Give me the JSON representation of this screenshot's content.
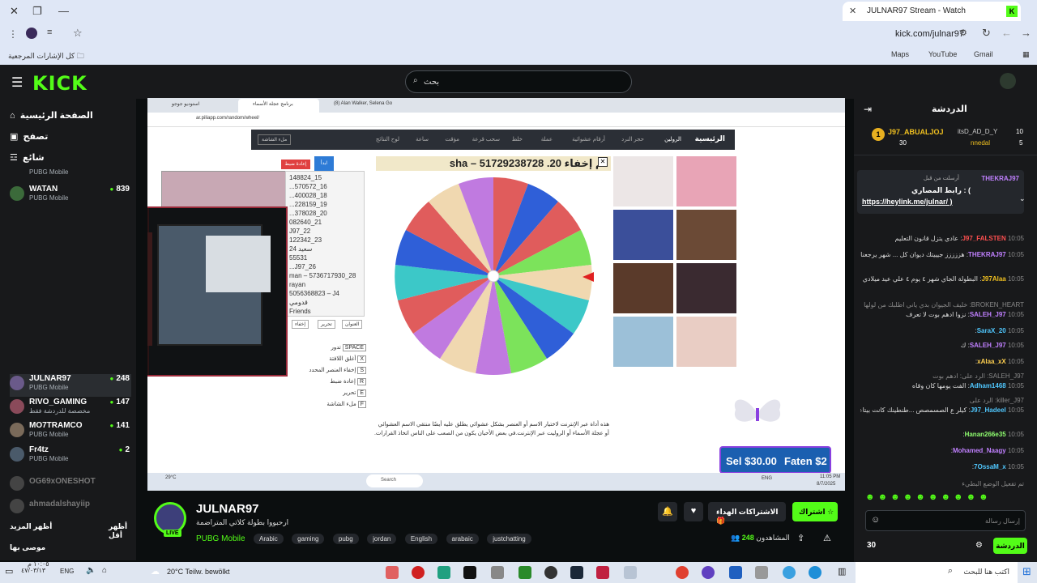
{
  "browser": {
    "tab_title": "JULNAR97 Stream - Watch",
    "tab_icon": "K",
    "url": "kick.com/julnar97",
    "bookmarks_folder": "كل الإشارات المرجعية",
    "bookmarks": [
      "Maps",
      "YouTube",
      "Gmail"
    ]
  },
  "kick": {
    "logo": "KICK",
    "search_placeholder": "بحث"
  },
  "sidebar": {
    "nav": [
      "الصفحة الرئيسية",
      "تصفح",
      "شائع"
    ],
    "channels": [
      {
        "name": "PUBG Mobile",
        "category": "",
        "viewers": ""
      },
      {
        "name": "WATAN",
        "category": "PUBG Mobile",
        "viewers": "839"
      },
      {
        "name": "JULNAR97",
        "category": "PUBG Mobile",
        "viewers": "248"
      },
      {
        "name": "RIVO_GAMING",
        "category": "مخصصة للدردشة فقط",
        "viewers": "147"
      },
      {
        "name": "MO7TRAMCO",
        "category": "PUBG Mobile",
        "viewers": "141"
      },
      {
        "name": "Fr4tz",
        "category": "PUBG Mobile",
        "viewers": "2"
      },
      {
        "name": "OG69xONESHOT",
        "category": "",
        "viewers": ""
      },
      {
        "name": "ahmadalshayiip",
        "category": "",
        "viewers": ""
      }
    ],
    "show_more": "أظهر المزيد",
    "show_less": "أظهر أقل",
    "recommended": "موصى بها"
  },
  "stream": {
    "browser_tabs": [
      "استوديو جوجو",
      "برنامج عجلة الأسماء",
      "(8) Alan Walker, Selena Go"
    ],
    "inner_url": "ar.piliapp.com/random/wheel/",
    "inner_nav": [
      "الرئيسية",
      "الرولين",
      "حجر النرد",
      "أرقام عشوائية",
      "عملة",
      "خلط",
      "سحب قرعة",
      "مؤقت",
      "ساعة",
      "لوح النتائج"
    ],
    "fullscreen": "ملء الشاشة",
    "ticker": "تم إخفاء 20. 51729238728 – sha",
    "buttons": [
      "ابدأ",
      "إعادة ضبط"
    ],
    "names": [
      "148824_15",
      "...570572_16",
      "...400028_18",
      "...228159_19",
      "...378028_20",
      "082640_21",
      "J97_22",
      "122342_23",
      "سعيد 24",
      "55531",
      "...J97_26",
      "man – 5736717930_28",
      "rayan",
      "5056368823 – J4",
      "قدومي",
      "Friends"
    ],
    "shortcuts": [
      "تدور",
      "أغلق اللافتة",
      "إخفاء العنصر المحدد",
      "إعادة ضبط",
      "تحرير",
      "ملء الشاشة"
    ],
    "shortcut_keys": [
      "SPACE",
      "X",
      "S",
      "R",
      "E",
      "F"
    ],
    "side_buttons": [
      "العنوان",
      "تحرير",
      "إخفاء"
    ],
    "description": "هذه أداة عبر الإنترنت لاختيار الاسم أو العنصر بشكل عشوائي يطلق عليه أيضًا منتقي الاسم العشوائي أو عجلة الأسماء أو الروليت عبر الإنترنت.في بعض الأحيان يكون من الصعب على الناس اتخاذ القرارات.",
    "donation_left": "Sel $30.00",
    "donation_right": "Faten $2",
    "weather_inner": "29°C",
    "search_inner": "Search",
    "time_inner": "11:05 PM",
    "date_inner": "8/7/2025",
    "lang_inner": "ENG"
  },
  "channel": {
    "name": "JULNAR97",
    "title": "ارحبووا بطولة كلاتي المتراضمة",
    "category": "PUBG Mobile",
    "live": "LIVE",
    "tags": [
      "Arabic",
      "gaming",
      "pubg",
      "jordan",
      "English",
      "arabaic",
      "justchatting"
    ],
    "follow": "اشتراك",
    "gift": "الاشتراكات الهداء",
    "viewers_label": "المشاهدون",
    "viewers": "248"
  },
  "chat": {
    "title": "الدردشة",
    "top": [
      {
        "name": "J97_ABUALJOJ",
        "count": "30"
      },
      {
        "name": "itsD_AD_D_Y",
        "count": "10"
      },
      {
        "name": "nnedal",
        "count": "5"
      }
    ],
    "pinned_user": "THEKRAJ97",
    "pinned_text": "أرسلت من قبل",
    "pinned_msg": "رابط المصاري : (",
    "pinned_link": "https://heylink.me/julnar/ )",
    "messages": [
      {
        "time": "10:05",
        "user": "J97_FALSTEN",
        "text": "عادي يتزل قانون التعليم"
      },
      {
        "time": "10:05",
        "user": "THEKRAJ97",
        "text": "هززززز جيييتك ديوان كل ... شهر يرجعنا عليكك"
      },
      {
        "time": "10:05",
        "user": "J97Alaa",
        "text": "البطولة الجاي شهر ٤ يوم ٤ علي عيد ميلادي احجولي"
      },
      {
        "time": "",
        "user": "BROKEN_HEART",
        "text": "خليف الجيوان بدي ياني اطلبك من لولها"
      },
      {
        "time": "10:05",
        "user": "SALEH_J97",
        "text": "نزوا ادهم بوت لا تعرف"
      },
      {
        "time": "10:05",
        "user": "SaraX_20",
        "text": ""
      },
      {
        "time": "10:05",
        "user": "SALEH_J97",
        "text": "ك"
      },
      {
        "time": "10:05",
        "user": "xAlaa_xX",
        "text": ""
      },
      {
        "time": "",
        "user": "SALEH_J97",
        "text": "الرد على: ادهم بوت"
      },
      {
        "time": "10:05",
        "user": "Adham1468",
        "text": "الفت يومها كان وقاه"
      },
      {
        "time": "",
        "user": "killer_J97",
        "text": "الرد على"
      },
      {
        "time": "10:05",
        "user": "J97_Hadeel",
        "text": "كيلر ع الصسمصص ...طنطينك كانت بيتاعني"
      },
      {
        "time": "10:05",
        "user": "Hanan266e35",
        "text": ""
      },
      {
        "time": "10:05",
        "user": "Mohamed_Naagy",
        "text": ""
      },
      {
        "time": "10:05",
        "user": "7OssaM_x",
        "text": ""
      },
      {
        "time": "",
        "user": "",
        "text": "تم تفعيل الوضع البطيء"
      }
    ],
    "input_placeholder": "إرسال رسالة",
    "points": "30",
    "send": "الدردشة"
  },
  "taskbar": {
    "weather": "20°C  Teilw. bewölkt",
    "search_placeholder": "اكتب هنا للبحث",
    "lang": "ENG",
    "time": "١٠:٠٥ م",
    "date": "٤٧/٠٣/١٣"
  },
  "colors": {
    "kick_green": "#53fc18",
    "bg": "#0b0e0f",
    "panel": "#18191b"
  }
}
